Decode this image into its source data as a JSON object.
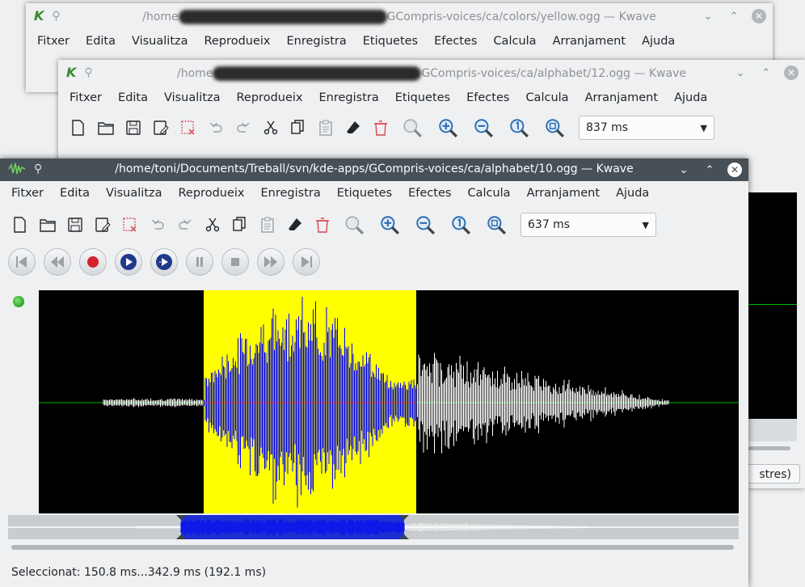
{
  "windows": {
    "back": {
      "title_prefix": "/home",
      "title_suffix": "GCompris-voices/ca/colors/yellow.ogg — Kwave"
    },
    "middle": {
      "title_prefix": "/home",
      "title_suffix": "GCompris-voices/ca/alphabet/12.ogg — Kwave",
      "zoom": "837 ms",
      "partial_text": "stres)"
    },
    "front": {
      "title": "/home/toni/Documents/Treball/svn/kde-apps/GCompris-voices/ca/alphabet/10.ogg — Kwave",
      "zoom": "637 ms",
      "status": "Seleccionat: 150.8 ms...342.9 ms (192.1 ms)"
    }
  },
  "menu": [
    "Fitxer",
    "Edita",
    "Visualitza",
    "Reprodueix",
    "Enregistra",
    "Etiquetes",
    "Efectes",
    "Calcula",
    "Arranjament",
    "Ajuda"
  ],
  "icons": {
    "toolbar": [
      "new-file-icon",
      "open-folder-icon",
      "save-icon",
      "save-as-icon",
      "close-file-icon",
      "undo-icon",
      "redo-icon",
      "cut-icon",
      "copy-icon",
      "paste-icon",
      "erase-icon",
      "delete-icon",
      "zoom-selection-icon",
      "zoom-in-icon",
      "zoom-out-icon",
      "zoom-original-icon",
      "zoom-all-icon"
    ],
    "playback": [
      "rewind-start-icon",
      "rewind-icon",
      "record-icon",
      "play-icon",
      "loop-icon",
      "pause-icon",
      "stop-icon",
      "forward-icon",
      "forward-end-icon"
    ]
  },
  "colors": {
    "selection": "#ffff00",
    "waveform_selected": "#0000ff",
    "waveform": "#ffffff",
    "background": "#000000",
    "baseline": "#00c000"
  }
}
